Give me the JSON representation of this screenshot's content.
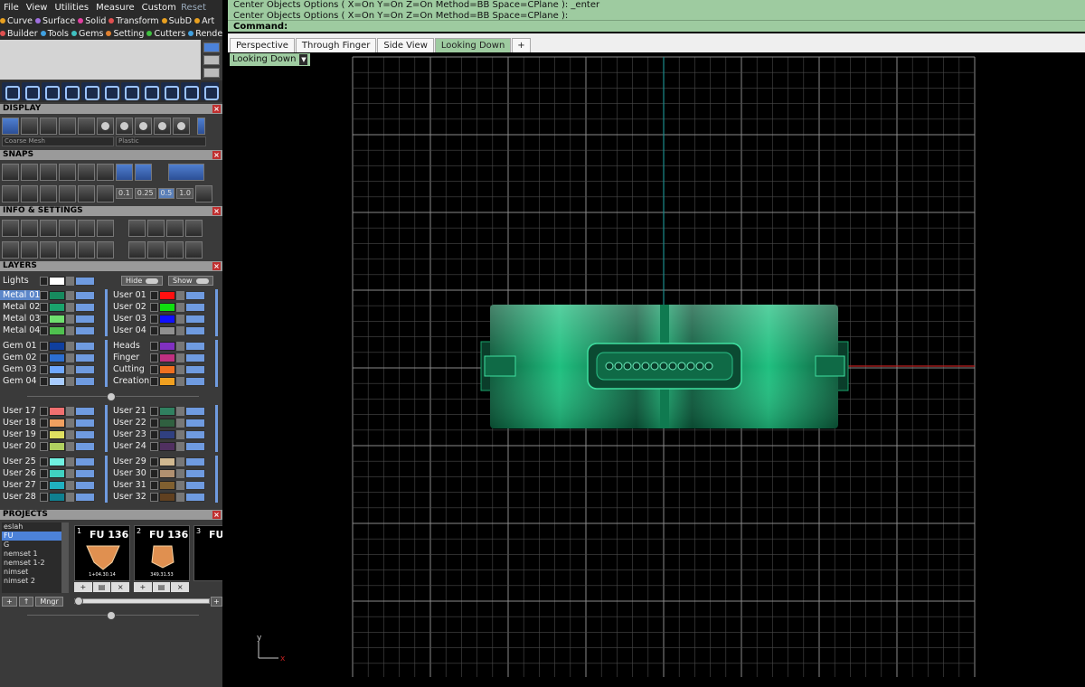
{
  "menu": {
    "items": [
      "File",
      "View",
      "Utilities",
      "Measure",
      "Custom"
    ],
    "reset": "Reset"
  },
  "tabs_row1": [
    {
      "label": "Curve",
      "color": "#e8a020"
    },
    {
      "label": "Surface",
      "color": "#a070e0"
    },
    {
      "label": "Solid",
      "color": "#e040a0"
    },
    {
      "label": "Transform",
      "color": "#e05050"
    },
    {
      "label": "SubD",
      "color": "#e8a020"
    },
    {
      "label": "Art",
      "color": "#e8a020"
    }
  ],
  "tabs_row2": [
    {
      "label": "Builder",
      "color": "#e05050"
    },
    {
      "label": "Tools",
      "color": "#40a0e0"
    },
    {
      "label": "Gems",
      "color": "#40c0c0"
    },
    {
      "label": "Setting",
      "color": "#e08030"
    },
    {
      "label": "Cutters",
      "color": "#40c040"
    },
    {
      "label": "Render",
      "color": "#40a0e0"
    }
  ],
  "sections": {
    "display": "DISPLAY",
    "snaps": "SNAPS",
    "info": "INFO & SETTINGS",
    "layers": "LAYERS",
    "projects": "PROJECTS"
  },
  "display": {
    "mesh": "Coarse Mesh",
    "material": "Plastic"
  },
  "snaps": {
    "values": [
      "0.1",
      "0.25",
      "0.5",
      "1.0"
    ]
  },
  "layers": {
    "lights": "Lights",
    "hide": "Hide",
    "show": "Show",
    "left_groups": [
      [
        {
          "name": "Metal 01",
          "color": "#178a5e",
          "on": true
        },
        {
          "name": "Metal 02",
          "color": "#1aa36c"
        },
        {
          "name": "Metal 03",
          "color": "#6fe06f"
        },
        {
          "name": "Metal 04",
          "color": "#4fc04f"
        }
      ],
      [
        {
          "name": "Gem 01",
          "color": "#103f9e"
        },
        {
          "name": "Gem 02",
          "color": "#2d6fd0"
        },
        {
          "name": "Gem 03",
          "color": "#6fa8ff"
        },
        {
          "name": "Gem 04",
          "color": "#a8ccff"
        }
      ],
      [
        {
          "name": "User 17",
          "color": "#f07070"
        },
        {
          "name": "User 18",
          "color": "#f0a060"
        },
        {
          "name": "User 19",
          "color": "#e0e060"
        },
        {
          "name": "User 20",
          "color": "#b0d060"
        }
      ],
      [
        {
          "name": "User 25",
          "color": "#70f0e0"
        },
        {
          "name": "User 26",
          "color": "#40d0c0"
        },
        {
          "name": "User 27",
          "color": "#20b0c0"
        },
        {
          "name": "User 28",
          "color": "#108090"
        }
      ]
    ],
    "right_groups": [
      [
        {
          "name": "User 01",
          "color": "#ff1010"
        },
        {
          "name": "User 02",
          "color": "#10e010"
        },
        {
          "name": "User 03",
          "color": "#1010ff"
        },
        {
          "name": "User 04",
          "color": "#909090"
        }
      ],
      [
        {
          "name": "Heads",
          "color": "#8030c0"
        },
        {
          "name": "Finger",
          "color": "#c03080"
        },
        {
          "name": "Cutting",
          "color": "#f07020"
        },
        {
          "name": "Creation",
          "color": "#f0a020"
        }
      ],
      [
        {
          "name": "User 21",
          "color": "#308060"
        },
        {
          "name": "User 22",
          "color": "#306040"
        },
        {
          "name": "User 23",
          "color": "#304080"
        },
        {
          "name": "User 24",
          "color": "#503060"
        }
      ],
      [
        {
          "name": "User 29",
          "color": "#d0b890"
        },
        {
          "name": "User 30",
          "color": "#b09070"
        },
        {
          "name": "User 31",
          "color": "#806030"
        },
        {
          "name": "User 32",
          "color": "#604020"
        }
      ]
    ]
  },
  "projects": {
    "list": [
      "eslah",
      "FU",
      "G",
      "nemset 1",
      "nemset 1-2",
      "nimset",
      "nimset 2"
    ],
    "selected": "FU",
    "thumbs": [
      {
        "num": "1",
        "title": "FU 136",
        "caption": "1+04.30.14"
      },
      {
        "num": "2",
        "title": "FU 136",
        "caption": "349.31.53"
      },
      {
        "num": "3",
        "title": "FU",
        "caption": ""
      }
    ],
    "mngr": "Mngr"
  },
  "command": {
    "history": [
      "Center Objects Options ( X=On  Y=On  Z=On  Method=BB  Space=CPlane ): _enter",
      "Center Objects Options ( X=On  Y=On  Z=On  Method=BB  Space=CPlane ):"
    ],
    "prompt": "Command:"
  },
  "viewport_tabs": [
    {
      "label": "Perspective"
    },
    {
      "label": "Through Finger"
    },
    {
      "label": "Side View"
    },
    {
      "label": "Looking Down",
      "active": true
    }
  ],
  "viewport_label": "Looking Down",
  "axis": {
    "y": "y",
    "x": "x"
  },
  "colors": {
    "accent_green": "#9ecba0",
    "layer_blue": "#6f9be0",
    "model_green": "#1aa36c",
    "x_axis": "#c02020",
    "y_axis": "#1a8c8c"
  }
}
